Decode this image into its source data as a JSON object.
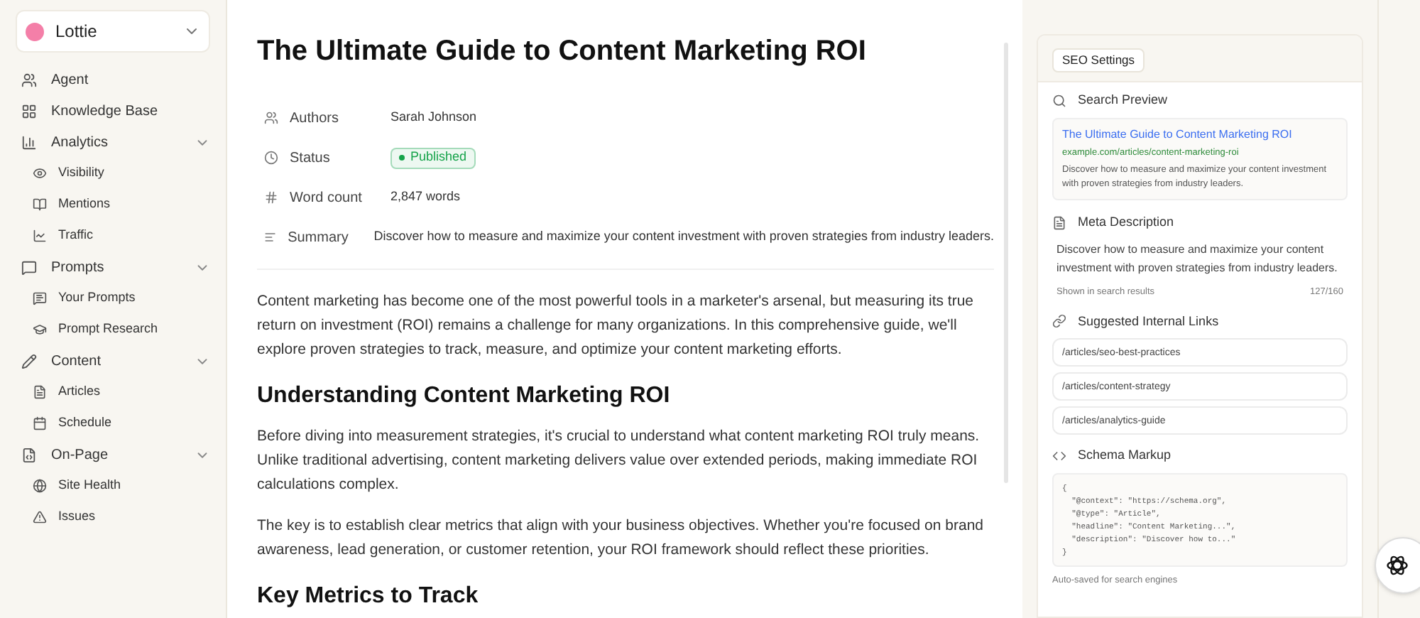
{
  "workspace": {
    "name": "Lottie"
  },
  "sidebar": {
    "items": [
      {
        "label": "Agent"
      },
      {
        "label": "Knowledge Base"
      },
      {
        "label": "Analytics",
        "expanded": true,
        "children": [
          {
            "label": "Visibility"
          },
          {
            "label": "Mentions"
          },
          {
            "label": "Traffic"
          }
        ]
      },
      {
        "label": "Prompts",
        "expanded": true,
        "children": [
          {
            "label": "Your Prompts"
          },
          {
            "label": "Prompt Research"
          }
        ]
      },
      {
        "label": "Content",
        "expanded": true,
        "children": [
          {
            "label": "Articles"
          },
          {
            "label": "Schedule"
          }
        ]
      },
      {
        "label": "On-Page",
        "expanded": true,
        "children": [
          {
            "label": "Site Health"
          },
          {
            "label": "Issues"
          }
        ]
      }
    ]
  },
  "article": {
    "title": "The Ultimate Guide to Content Marketing ROI",
    "properties": [
      {
        "label": "Authors",
        "kind": "text",
        "value": "Sarah Johnson"
      },
      {
        "label": "Status",
        "kind": "badge",
        "value": "Published",
        "color": "#16a34a"
      },
      {
        "label": "Word count",
        "kind": "text",
        "value": "2,847 words"
      },
      {
        "label": "Summary",
        "kind": "text",
        "value": "Discover how to measure and maximize your content investment with proven strategies from industry leaders."
      }
    ],
    "body": [
      {
        "kind": "paragraph",
        "text": "Content marketing has become one of the most powerful tools in a marketer's arsenal, but measuring its true return on investment (ROI) remains a challenge for many organizations. In this comprehensive guide, we'll explore proven strategies to track, measure, and optimize your content marketing efforts."
      },
      {
        "kind": "heading",
        "text": "Understanding Content Marketing ROI"
      },
      {
        "kind": "paragraph",
        "text": "Before diving into measurement strategies, it's crucial to understand what content marketing ROI truly means. Unlike traditional advertising, content marketing delivers value over extended periods, making immediate ROI calculations complex."
      },
      {
        "kind": "paragraph",
        "text": "The key is to establish clear metrics that align with your business objectives. Whether you're focused on brand awareness, lead generation, or customer retention, your ROI framework should reflect these priorities."
      },
      {
        "kind": "heading",
        "text": "Key Metrics to Track"
      }
    ]
  },
  "seo_panel": {
    "tab": "SEO Settings",
    "search_preview": {
      "heading": "Search Preview",
      "title": "The Ultimate Guide to Content Marketing ROI",
      "url": "example.com/articles/content-marketing-roi",
      "description": "Discover how to measure and maximize your content investment with proven strategies from industry leaders."
    },
    "meta_description": {
      "heading": "Meta Description",
      "text": "Discover how to measure and maximize your content investment with proven strategies from industry leaders.",
      "hint": "Shown in search results",
      "count": "127/160"
    },
    "internal_links": {
      "heading": "Suggested Internal Links",
      "links": [
        "/articles/seo-best-practices",
        "/articles/content-strategy",
        "/articles/analytics-guide"
      ]
    },
    "schema_markup": {
      "heading": "Schema Markup",
      "lines": [
        "{",
        "  \"@context\": \"https://schema.org\",",
        "  \"@type\": \"Article\",",
        "  \"headline\": \"Content Marketing...\",",
        "  \"description\": \"Discover how to...\"",
        "}"
      ],
      "note": "Auto-saved for search engines"
    }
  }
}
